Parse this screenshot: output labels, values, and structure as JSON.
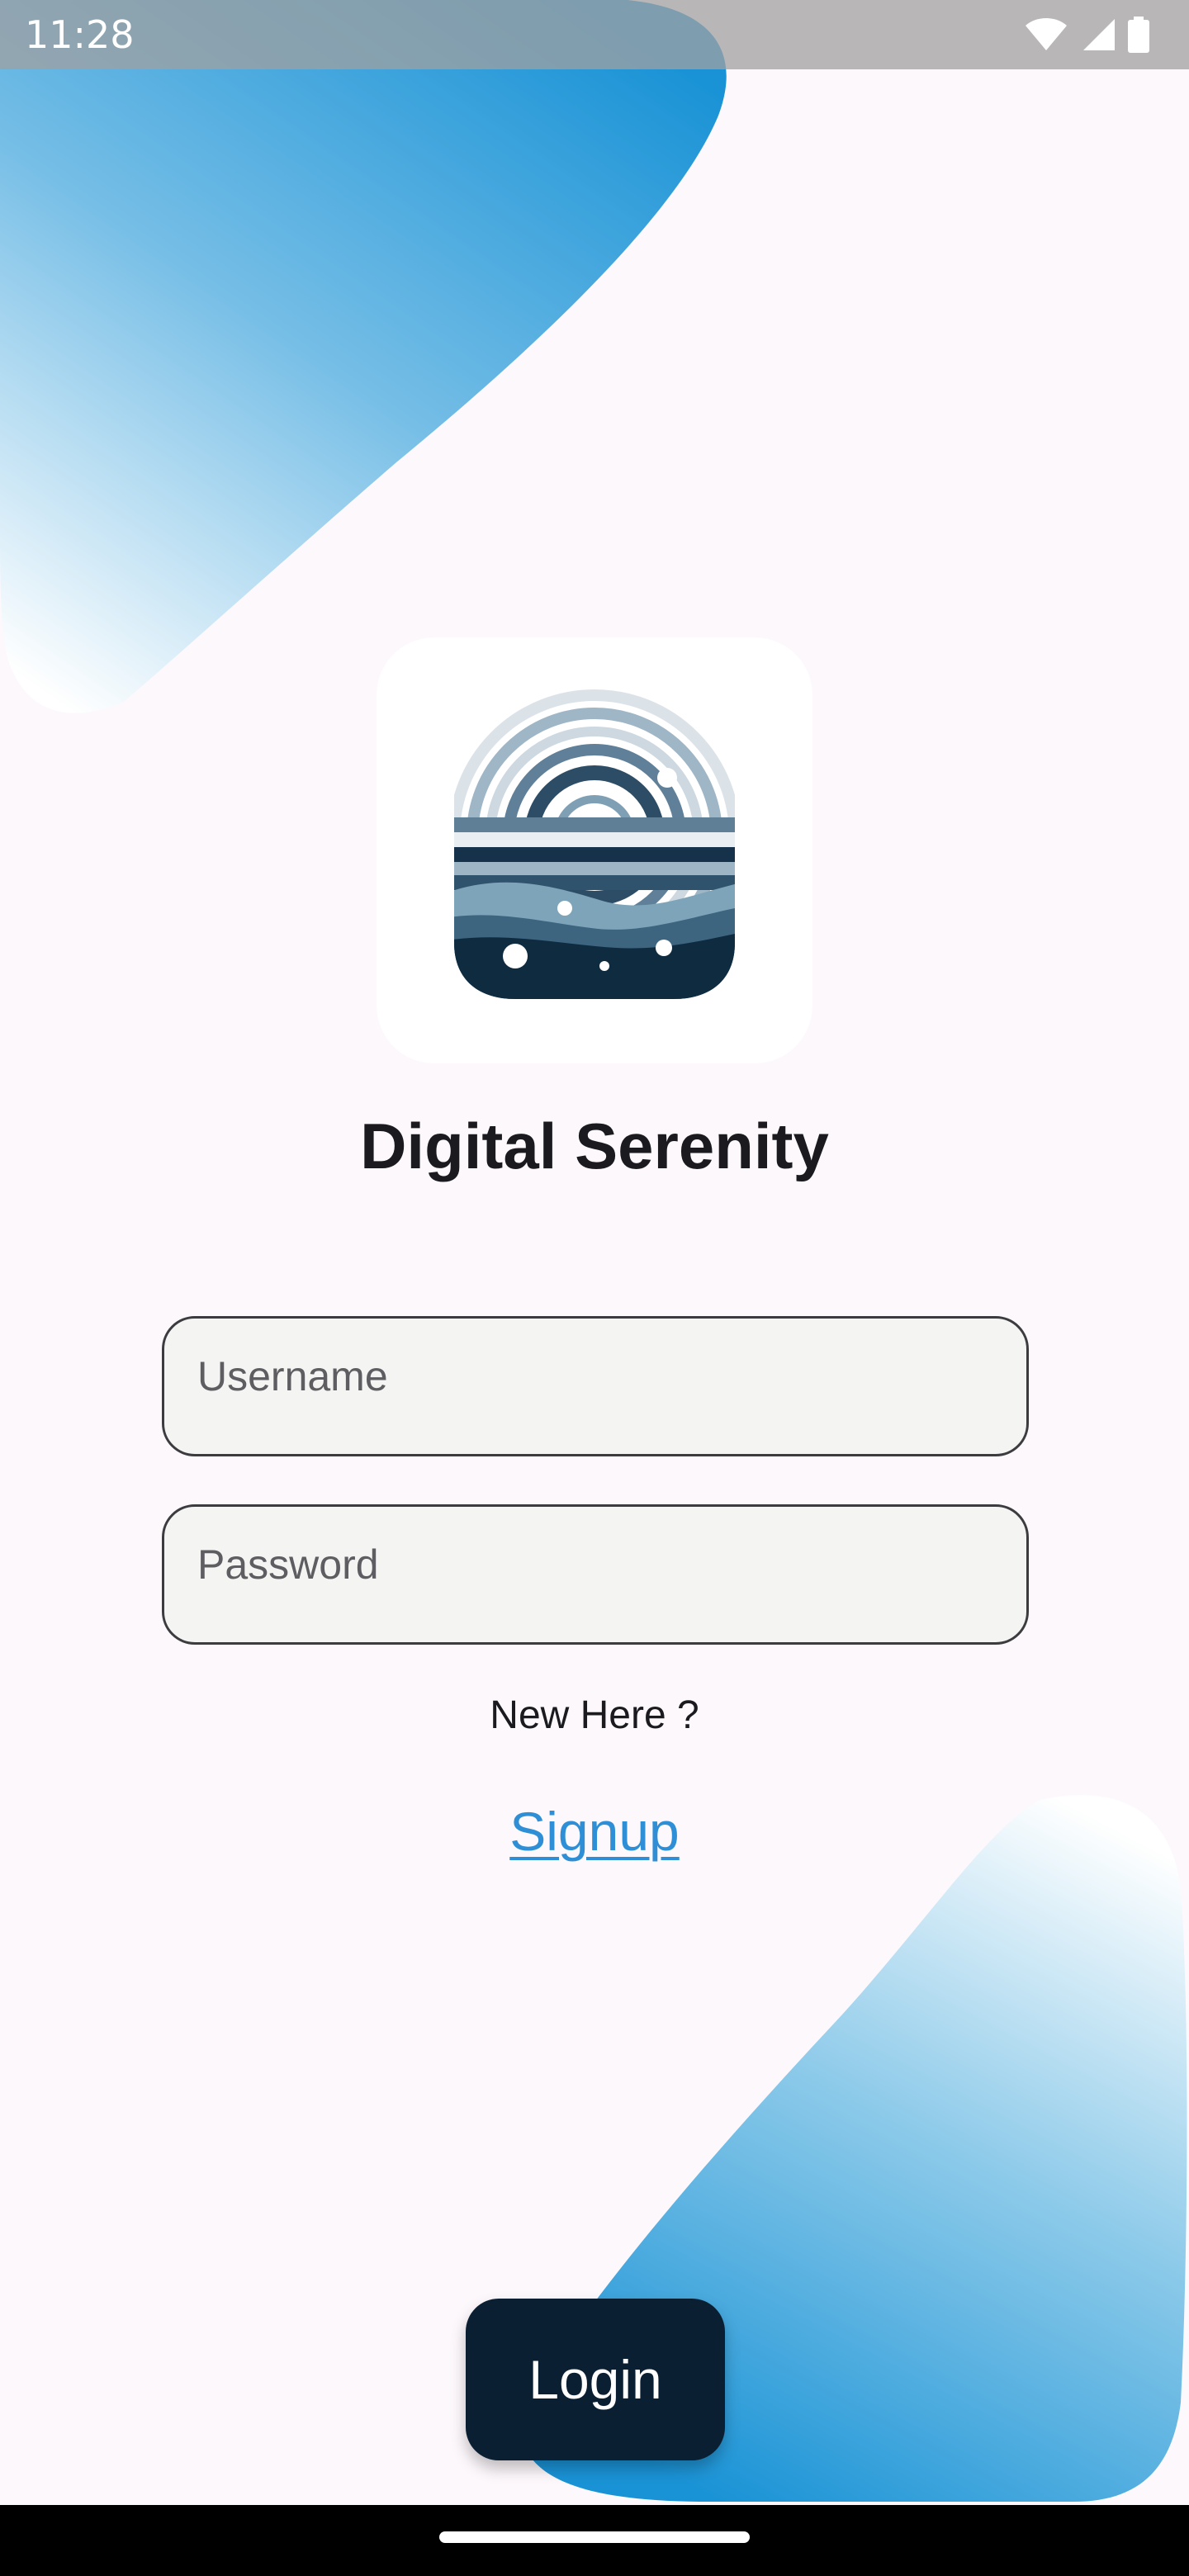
{
  "status_bar": {
    "time": "11:28",
    "icons": [
      "wifi-icon",
      "signal-icon",
      "battery-icon"
    ]
  },
  "app": {
    "title": "Digital Serenity",
    "logo": "digital-serenity-logo"
  },
  "form": {
    "username_placeholder": "Username",
    "password_placeholder": "Password"
  },
  "signup": {
    "prompt": "New Here ?",
    "link_label": "Signup"
  },
  "login": {
    "label": "Login"
  },
  "colors": {
    "background": "#fdf8fc",
    "accent_blue": "#2196d8",
    "button_dark": "#0b1f33",
    "link_blue": "#2f8fd6"
  }
}
